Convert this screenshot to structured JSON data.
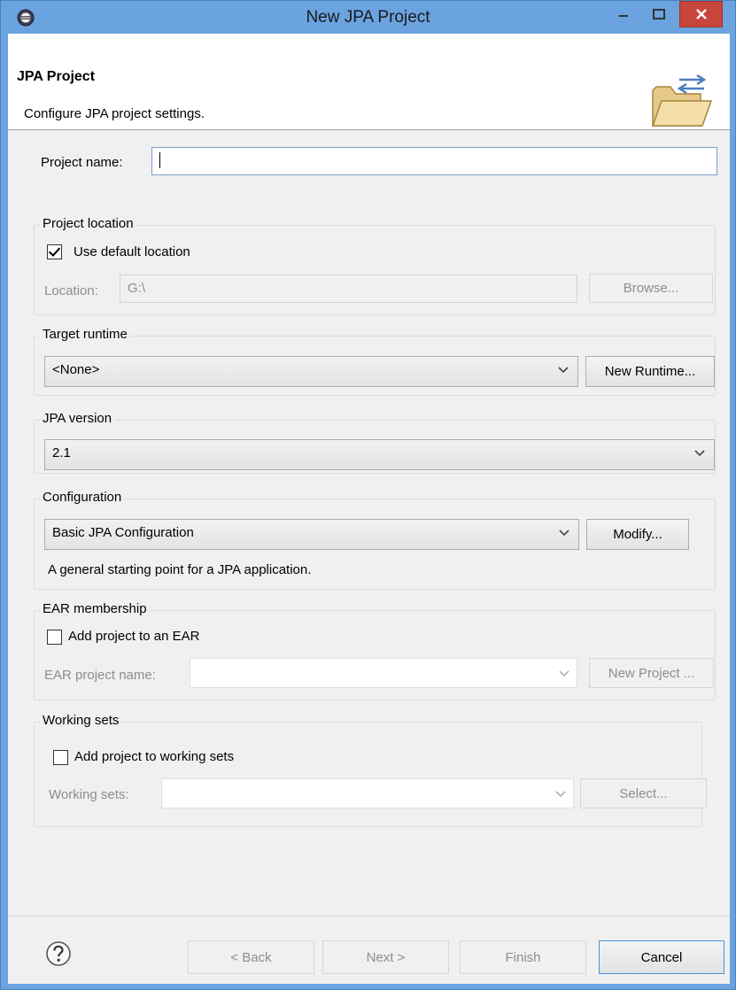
{
  "window": {
    "title": "New JPA Project",
    "app_icon": "eclipse-gear-icon",
    "minimize_icon": "minimize-icon",
    "maximize_icon": "maximize-icon",
    "close_icon": "close-icon",
    "close_color": "#c7463c"
  },
  "header": {
    "title": "JPA Project",
    "description": "Configure JPA project settings.",
    "icon": "folder-wizard-icon"
  },
  "project_name": {
    "label": "Project name:",
    "value": ""
  },
  "project_location": {
    "group_title": "Project location",
    "use_default_label": "Use default location",
    "use_default_checked": true,
    "location_label": "Location:",
    "location_value": "G:\\",
    "browse_label": "Browse..."
  },
  "target_runtime": {
    "group_title": "Target runtime",
    "selected": "<None>",
    "new_runtime_label": "New Runtime..."
  },
  "jpa_version": {
    "group_title": "JPA version",
    "selected": "2.1"
  },
  "configuration": {
    "group_title": "Configuration",
    "selected": "Basic JPA Configuration",
    "modify_label": "Modify...",
    "description": "A general starting point for a JPA application."
  },
  "ear_membership": {
    "group_title": "EAR membership",
    "add_label": "Add project to an EAR",
    "add_checked": false,
    "name_label": "EAR project name:",
    "name_value": "",
    "new_project_label": "New Project ..."
  },
  "working_sets": {
    "group_title": "Working sets",
    "add_label": "Add project to working sets",
    "add_checked": false,
    "sets_label": "Working sets:",
    "sets_value": "",
    "select_label": "Select..."
  },
  "footer": {
    "help_icon": "help-icon",
    "back_label": "< Back",
    "next_label": "Next >",
    "finish_label": "Finish",
    "cancel_label": "Cancel"
  },
  "colors": {
    "frame": "#6aa3e0",
    "client_bg": "#f0f0f0",
    "header_bg": "#ffffff",
    "disabled_text": "#8d8d8d"
  }
}
